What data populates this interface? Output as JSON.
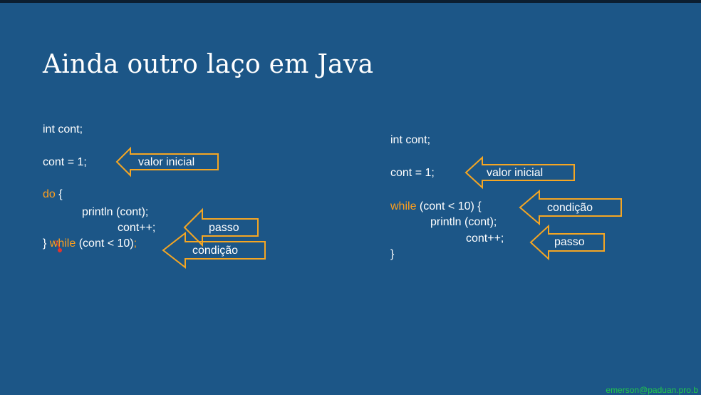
{
  "slide": {
    "title": "Ainda outro laço em Java",
    "footer": "emerson@paduan.pro.b"
  },
  "left": {
    "line_decl": "int cont;",
    "line_init": "cont = 1;",
    "kw_do": "do",
    "brace_open": " {",
    "line_println": "println (cont);",
    "line_incr": "cont++;",
    "brace_close": "} ",
    "kw_while": "while",
    "cond_rest": " (cont < 10)",
    "semicolon": ";",
    "callouts": {
      "initial": "valor inicial",
      "step": "passo",
      "condition": "condição"
    }
  },
  "right": {
    "line_decl": "int cont;",
    "line_init": "cont = 1;",
    "kw_while": "while",
    "cond_rest": " (cont < 10) {",
    "line_println": "println (cont);",
    "line_incr": "cont++;",
    "brace_close": "}",
    "callouts": {
      "initial": "valor inicial",
      "condition": "condição",
      "step": "passo"
    }
  },
  "colors": {
    "background": "#1c5687",
    "keyword": "#ff9f1c",
    "callout_border": "#f5a623",
    "text": "#ffffff",
    "footer": "#21c94a"
  },
  "icons": {
    "callout_arrow": "left-arrow-callout-icon",
    "cursor": "pen-cursor-icon"
  }
}
